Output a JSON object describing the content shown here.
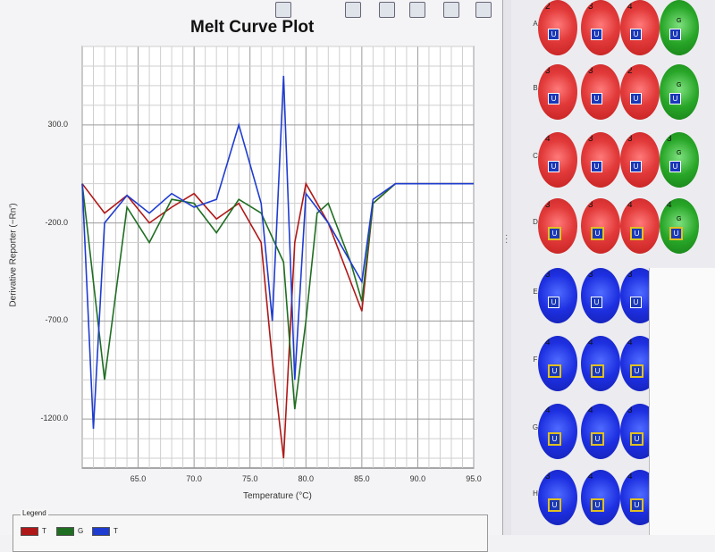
{
  "plot": {
    "title": "Melt Curve Plot",
    "ylabel": "Derivative Reporter (−Rn')",
    "xlabel": "Temperature (°C)",
    "yticks": [
      "300.0",
      "-200.0",
      "-700.0",
      "-1200.0"
    ],
    "xticks": [
      "65.0",
      "70.0",
      "75.0",
      "80.0",
      "85.0",
      "90.0",
      "95.0"
    ]
  },
  "legend": {
    "title": "Legend",
    "items": [
      {
        "label": "T",
        "color": "#b01818"
      },
      {
        "label": "G",
        "color": "#1f6e22"
      },
      {
        "label": "T",
        "color": "#1f3cd0"
      }
    ]
  },
  "toolbar_icons": [
    "zoom-icon",
    "print-icon",
    "export-icon",
    "copy-icon",
    "plot-settings-icon",
    "list-icon"
  ],
  "plate": {
    "rows": [
      "A",
      "B",
      "C",
      "D",
      "E",
      "F",
      "G",
      "H"
    ],
    "wells": [
      [
        {
          "n": "2",
          "color": "red",
          "t": "U"
        },
        {
          "n": "3",
          "color": "red",
          "t": "U"
        },
        {
          "n": "4",
          "color": "red",
          "t": "U"
        },
        {
          "n": "",
          "color": "green",
          "t": "U",
          "g": "G"
        }
      ],
      [
        {
          "n": "3",
          "color": "red",
          "t": "U"
        },
        {
          "n": "3",
          "color": "red",
          "t": "U"
        },
        {
          "n": "2",
          "color": "red",
          "t": "U"
        },
        {
          "n": "",
          "color": "green",
          "t": "U",
          "g": "G"
        }
      ],
      [
        {
          "n": "4",
          "color": "red",
          "t": "U"
        },
        {
          "n": "3",
          "color": "red",
          "t": "U"
        },
        {
          "n": "3",
          "color": "red",
          "t": "U"
        },
        {
          "n": "3",
          "color": "green",
          "t": "U",
          "g": "G"
        }
      ],
      [
        {
          "n": "3",
          "color": "red",
          "t": "U"
        },
        {
          "n": "3",
          "color": "red",
          "t": "U"
        },
        {
          "n": "4",
          "color": "red",
          "t": "U"
        },
        {
          "n": "4",
          "color": "green",
          "t": "U",
          "g": "G"
        }
      ],
      [
        {
          "n": "3",
          "color": "blue",
          "t": "U"
        },
        {
          "n": "3",
          "color": "blue",
          "t": "U"
        },
        {
          "n": "3",
          "color": "blue",
          "t": "U"
        }
      ],
      [
        {
          "n": "4",
          "color": "blue",
          "t": "U"
        },
        {
          "n": "4",
          "color": "blue",
          "t": "U"
        },
        {
          "n": "4",
          "color": "blue",
          "t": "U"
        }
      ],
      [
        {
          "n": "4",
          "color": "blue",
          "t": "U"
        },
        {
          "n": "4",
          "color": "blue",
          "t": "U"
        },
        {
          "n": "3",
          "color": "blue",
          "t": "U"
        }
      ],
      [
        {
          "n": "3",
          "color": "blue",
          "t": "U"
        },
        {
          "n": "4",
          "color": "blue",
          "t": "U"
        },
        {
          "n": "4",
          "color": "blue",
          "t": "U"
        }
      ]
    ]
  },
  "chart_data": {
    "type": "line",
    "title": "Melt Curve Plot",
    "xlabel": "Temperature (°C)",
    "ylabel": "Derivative Reporter (−Rn')",
    "xlim": [
      60.0,
      95.0
    ],
    "ylim": [
      -1450,
      700
    ],
    "grid": true,
    "legend_position": "bottom",
    "series": [
      {
        "name": "T",
        "color": "#b01818",
        "x": [
          60,
          62,
          64,
          66,
          68,
          70,
          72,
          74,
          76,
          77,
          78,
          79,
          80,
          82,
          84,
          85,
          86,
          88,
          90,
          95
        ],
        "y": [
          0,
          -150,
          -60,
          -200,
          -120,
          -50,
          -180,
          -100,
          -300,
          -900,
          -1400,
          -300,
          0,
          -200,
          -500,
          -650,
          -100,
          0,
          0,
          0
        ]
      },
      {
        "name": "G",
        "color": "#1f6e22",
        "x": [
          60,
          62,
          64,
          66,
          68,
          70,
          72,
          74,
          76,
          78,
          79,
          80,
          81,
          82,
          84,
          85,
          86,
          88,
          90,
          95
        ],
        "y": [
          0,
          -1000,
          -120,
          -300,
          -80,
          -100,
          -250,
          -80,
          -150,
          -400,
          -1150,
          -700,
          -150,
          -100,
          -400,
          -600,
          -100,
          0,
          0,
          0
        ]
      },
      {
        "name": "T",
        "color": "#1f3cd0",
        "x": [
          60,
          61,
          62,
          64,
          66,
          68,
          70,
          72,
          74,
          76,
          77,
          78,
          79,
          80,
          82,
          84,
          85,
          86,
          88,
          90,
          95
        ],
        "y": [
          0,
          -1250,
          -200,
          -60,
          -150,
          -50,
          -120,
          -80,
          300,
          -100,
          -700,
          550,
          -1000,
          -50,
          -200,
          -400,
          -500,
          -80,
          0,
          0,
          0
        ]
      }
    ]
  }
}
